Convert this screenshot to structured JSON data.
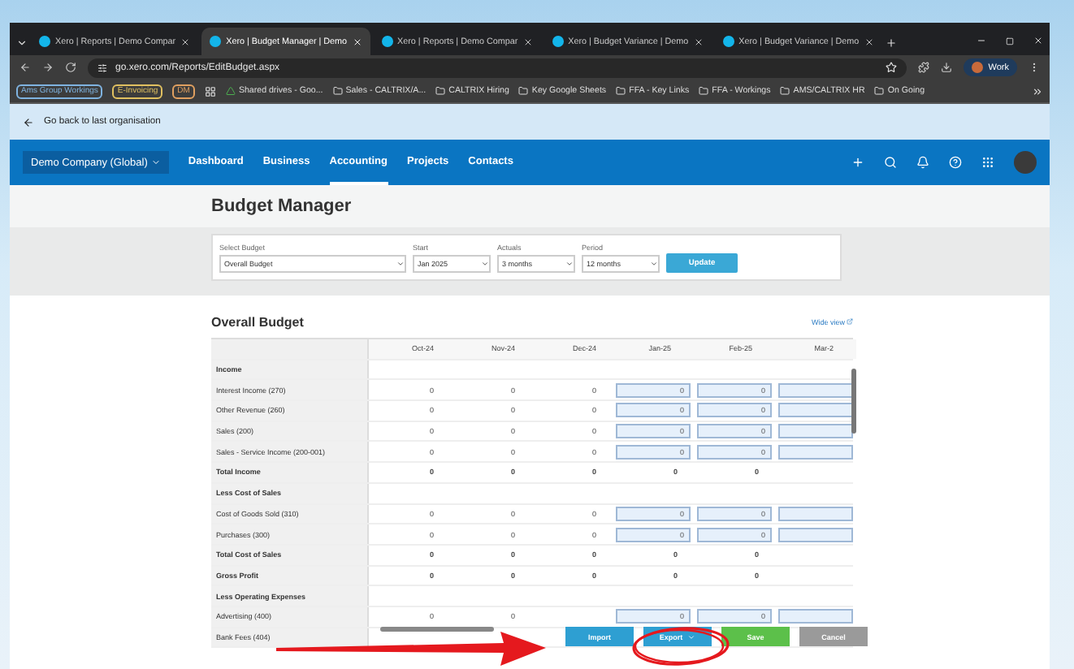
{
  "browser": {
    "tabs": [
      {
        "title": "Xero | Reports | Demo Compar",
        "selected": false
      },
      {
        "title": "Xero | Budget Manager | Demo",
        "selected": true
      },
      {
        "title": "Xero | Reports | Demo Compar",
        "selected": false
      },
      {
        "title": "Xero | Budget Variance | Demo",
        "selected": false
      },
      {
        "title": "Xero | Budget Variance | Demo",
        "selected": false
      }
    ],
    "address": "go.xero.com/Reports/EditBudget.aspx",
    "profile": "Work",
    "bookmarks": [
      {
        "label": "Ams Group Workings",
        "kind": "badge",
        "color": "#7fb3e0"
      },
      {
        "label": "E-Invoicing",
        "kind": "badge",
        "color": "#e0c060"
      },
      {
        "label": "DM",
        "kind": "badge",
        "color": "#e0a060"
      },
      {
        "kind": "apps"
      },
      {
        "label": "Shared drives - Goo...",
        "kind": "drive"
      },
      {
        "label": "Sales - CALTRIX/A...",
        "kind": "folder"
      },
      {
        "label": "CALTRIX Hiring",
        "kind": "folder"
      },
      {
        "label": "Key Google Sheets",
        "kind": "folder"
      },
      {
        "label": "FFA - Key Links",
        "kind": "folder"
      },
      {
        "label": "FFA - Workings",
        "kind": "folder"
      },
      {
        "label": "AMS/CALTRIX HR",
        "kind": "folder"
      },
      {
        "label": "On Going",
        "kind": "folder"
      }
    ]
  },
  "back_link": "Go back to last organisation",
  "nav": {
    "organisation": "Demo Company (Global)",
    "links": [
      {
        "label": "Dashboard",
        "selected": false
      },
      {
        "label": "Business",
        "selected": false
      },
      {
        "label": "Accounting",
        "selected": true
      },
      {
        "label": "Projects",
        "selected": false
      },
      {
        "label": "Contacts",
        "selected": false
      }
    ]
  },
  "title": "Budget Manager",
  "filters": [
    {
      "label": "Select Budget",
      "value": "Overall Budget"
    },
    {
      "label": "Start",
      "value": "Jan 2025"
    },
    {
      "label": "Actuals",
      "value": "3 months"
    },
    {
      "label": "Period",
      "value": "12 months"
    }
  ],
  "update_button": "Update",
  "budget": {
    "title": "Overall Budget",
    "wide_view": "Wide view",
    "columns": [
      {
        "label": "Oct-24",
        "kind": "actual"
      },
      {
        "label": "Nov-24",
        "kind": "actual"
      },
      {
        "label": "Dec-24",
        "kind": "actual"
      },
      {
        "label": "Jan-25",
        "kind": "budget"
      },
      {
        "label": "Feb-25",
        "kind": "budget"
      },
      {
        "label": "Mar-2",
        "kind": "budget"
      }
    ],
    "rows": [
      {
        "label": "Income",
        "kind": "heading"
      },
      {
        "label": "Interest Income (270)",
        "kind": "account",
        "actuals": [
          "0",
          "0",
          "0"
        ],
        "budget": [
          "0",
          "0"
        ]
      },
      {
        "label": "Other Revenue (260)",
        "kind": "account",
        "actuals": [
          "0",
          "0",
          "0"
        ],
        "budget": [
          "0",
          "0"
        ]
      },
      {
        "label": "Sales (200)",
        "kind": "account",
        "actuals": [
          "0",
          "0",
          "0"
        ],
        "budget": [
          "0",
          "0"
        ]
      },
      {
        "label": "Sales - Service Income (200-001)",
        "kind": "account",
        "actuals": [
          "0",
          "0",
          "0"
        ],
        "budget": [
          "0",
          "0"
        ]
      },
      {
        "label": "Total Income",
        "kind": "total",
        "values": [
          "0",
          "0",
          "0",
          "0",
          "0"
        ]
      },
      {
        "label": "Less Cost of Sales",
        "kind": "heading"
      },
      {
        "label": "Cost of Goods Sold (310)",
        "kind": "account",
        "actuals": [
          "0",
          "0",
          "0"
        ],
        "budget": [
          "0",
          "0"
        ]
      },
      {
        "label": "Purchases (300)",
        "kind": "account",
        "actuals": [
          "0",
          "0",
          "0"
        ],
        "budget": [
          "0",
          "0"
        ]
      },
      {
        "label": "Total Cost of Sales",
        "kind": "total",
        "values": [
          "0",
          "0",
          "0",
          "0",
          "0"
        ]
      },
      {
        "label": "Gross Profit",
        "kind": "total",
        "values": [
          "0",
          "0",
          "0",
          "0",
          "0"
        ]
      },
      {
        "label": "Less Operating Expenses",
        "kind": "heading"
      },
      {
        "label": "Advertising (400)",
        "kind": "account",
        "actuals": [
          "0",
          "0"
        ],
        "budget": [
          "0",
          "0"
        ]
      },
      {
        "label": "Bank Fees (404)",
        "kind": "account"
      }
    ],
    "buttons": [
      {
        "label": "Import",
        "kind": "import"
      },
      {
        "label": "Export",
        "kind": "export"
      },
      {
        "label": "Save",
        "kind": "save"
      },
      {
        "label": "Cancel",
        "kind": "cancel"
      }
    ]
  }
}
